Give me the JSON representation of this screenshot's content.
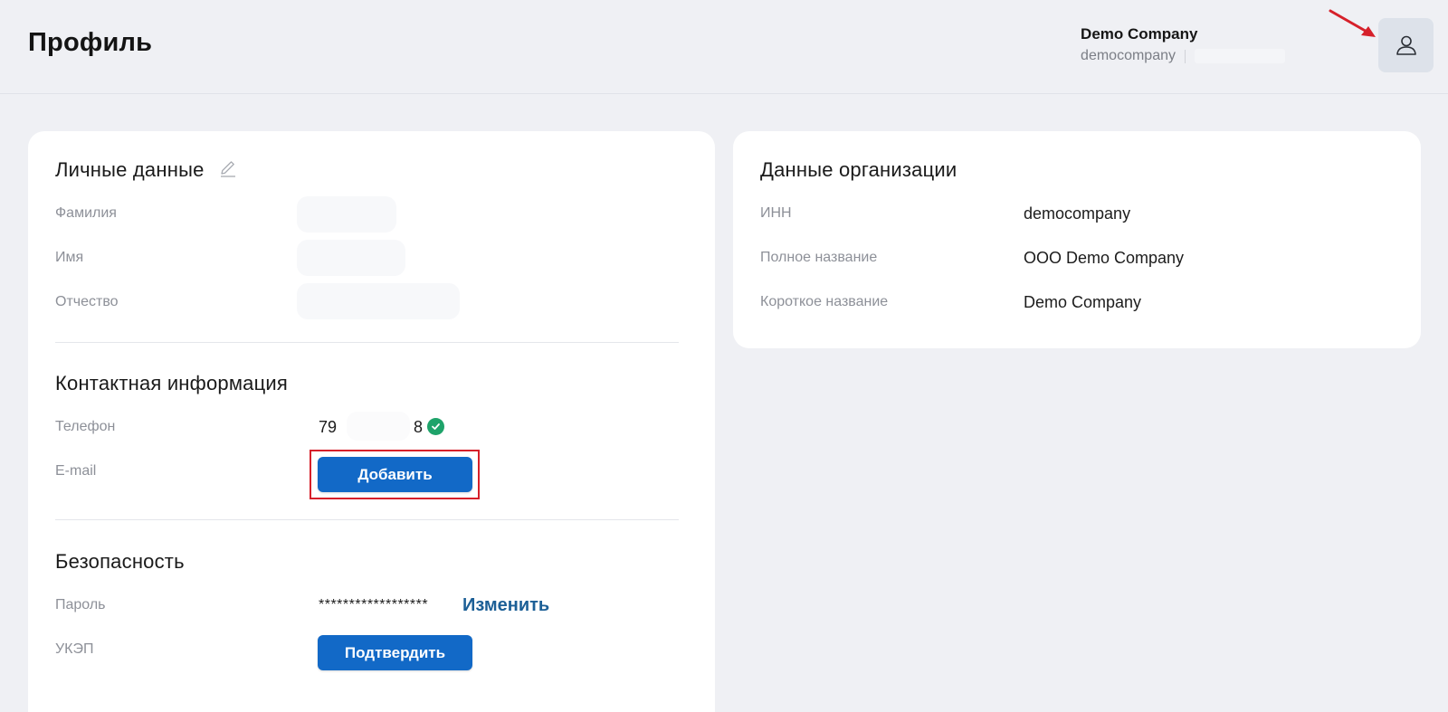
{
  "header": {
    "title": "Профиль",
    "company_name": "Demo Company",
    "company_login": "democompany",
    "avatar_icon": "user-icon"
  },
  "personal": {
    "title": "Личные данные",
    "edit_icon": "pencil-icon",
    "fields": [
      {
        "label": "Фамилия"
      },
      {
        "label": "Имя"
      },
      {
        "label": "Отчество"
      }
    ]
  },
  "contact": {
    "title": "Контактная информация",
    "phone_label": "Телефон",
    "phone_prefix": "79",
    "phone_suffix": "8",
    "phone_verified_icon": "check-circle-icon",
    "email_label": "E-mail",
    "email_add_button": "Добавить"
  },
  "security": {
    "title": "Безопасность",
    "password_label": "Пароль",
    "password_value": "******************",
    "password_change_link": "Изменить",
    "ukep_label": "УКЭП",
    "ukep_confirm_button": "Подтвердить"
  },
  "organization": {
    "title": "Данные организации",
    "fields": [
      {
        "label": "ИНН",
        "value": "democompany"
      },
      {
        "label": "Полное название",
        "value": "ООО Demo Company"
      },
      {
        "label": "Короткое название",
        "value": "Demo Company"
      }
    ]
  },
  "colors": {
    "primary_button": "#1269c7",
    "link": "#1c5f96",
    "highlight": "#d6202a",
    "verified": "#1ea36a",
    "background": "#eff0f4"
  }
}
